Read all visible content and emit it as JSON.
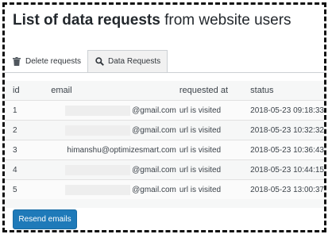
{
  "page": {
    "title_bold": "List of data requests",
    "title_rest": " from website users"
  },
  "tabs": [
    {
      "label": "Delete requests",
      "icon": "trash-icon"
    },
    {
      "label": "Data Requests",
      "icon": "search-icon",
      "active": true
    }
  ],
  "table": {
    "headers": [
      "id",
      "email",
      "requested at",
      "status"
    ],
    "rows": [
      {
        "id": "1",
        "email": "@gmail.com",
        "email_partially_redacted": true,
        "requested_at": "url is visited",
        "status": "2018-05-23 09:18:33"
      },
      {
        "id": "2",
        "email": "@gmail.com",
        "email_partially_redacted": true,
        "requested_at": "url is visited",
        "status": "2018-05-23 10:32:32"
      },
      {
        "id": "3",
        "email": "himanshu@optimizesmart.com",
        "email_partially_redacted": false,
        "requested_at": "url is visited",
        "status": "2018-05-23 10:36:43"
      },
      {
        "id": "4",
        "email": "@gmail.com",
        "email_partially_redacted": true,
        "requested_at": "url is visited",
        "status": "2018-05-23 10:44:15"
      },
      {
        "id": "5",
        "email": "@gmail.com",
        "email_partially_redacted": true,
        "requested_at": "url is visited",
        "status": "2018-05-23 13:00:37"
      }
    ]
  },
  "actions": {
    "resend_label": "Resend emails"
  },
  "colors": {
    "primary_button": "#1f7ab9",
    "frame_border": "#111111"
  }
}
